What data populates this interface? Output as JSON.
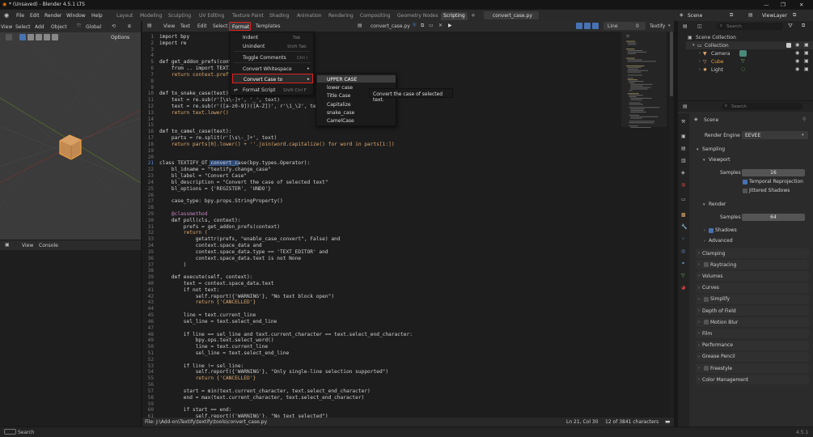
{
  "titlebar": {
    "title": "* (Unsaved) - Blender 4.5.1 LTS",
    "minimize": "—",
    "maximize": "❐",
    "close": "✕"
  },
  "topbar": {
    "menus": [
      "File",
      "Edit",
      "Render",
      "Window",
      "Help"
    ],
    "workspaces": [
      "Layout",
      "Modeling",
      "Sculpting",
      "UV Editing",
      "Texture Paint",
      "Shading",
      "Animation",
      "Rendering",
      "Compositing",
      "Geometry Nodes",
      "Scripting"
    ],
    "active_workspace": "Scripting",
    "add_tab": "+",
    "file_tab": "convert_case.py",
    "scene_label": "Scene",
    "view_layer_label": "ViewLayer"
  },
  "viewport": {
    "header_menus": [
      "View",
      "Select",
      "Add",
      "Object"
    ],
    "transform_orientation": "Global",
    "options_label": "Options"
  },
  "console": {
    "menus": [
      "View",
      "Console"
    ]
  },
  "editor_header": {
    "menus": [
      "View",
      "Text",
      "Edit",
      "Select",
      "Format",
      "Templates"
    ],
    "active_menu": "Format",
    "file_name": "convert_case.py",
    "line_label": "Line",
    "line_value": "0",
    "addon_label": "Textify"
  },
  "format_menu": {
    "items": [
      {
        "label": "Indent",
        "shortcut": "Tab"
      },
      {
        "label": "Unindent",
        "shortcut": "Shift Tab"
      },
      {
        "label": "Toggle Comments",
        "shortcut": "Ctrl /"
      },
      {
        "label": "Convert Whitespace",
        "shortcut": "▸"
      },
      {
        "label": "Convert Case to",
        "shortcut": "▸"
      },
      {
        "label": "Format Script",
        "shortcut": "Shift Ctrl F"
      }
    ]
  },
  "case_submenu": {
    "items": [
      "UPPER CASE",
      "lower case",
      "Title Case",
      "Capitalize",
      "snake_case",
      "CamelCase"
    ],
    "tooltip": "Convert the case of selected text."
  },
  "code_lines": [
    {
      "n": "1",
      "text": "import bpy"
    },
    {
      "n": "2",
      "text": "import re"
    },
    {
      "n": "3",
      "text": ""
    },
    {
      "n": "4",
      "text": ""
    },
    {
      "n": "5",
      "text": "def get_addon_prefs(cont"
    },
    {
      "n": "6",
      "text": "    from .. import TEXTI"
    },
    {
      "n": "7",
      "text": "    return context.pref"
    },
    {
      "n": "8",
      "text": ""
    },
    {
      "n": "9",
      "text": ""
    },
    {
      "n": "10",
      "text": "def to_snake_case(text)"
    },
    {
      "n": "11",
      "text": "    text = re.sub(r'[\\s\\-]+', '_', text)"
    },
    {
      "n": "12",
      "text": "    text = re.sub(r'([a-z0-9])([A-Z])', r'\\1_\\2', te"
    },
    {
      "n": "13",
      "text": "    return text.lower()"
    },
    {
      "n": "14",
      "text": ""
    },
    {
      "n": "15",
      "text": ""
    },
    {
      "n": "16",
      "text": "def to_camel_case(text):"
    },
    {
      "n": "17",
      "text": "    parts = re.split(r'[\\s\\-_]+', text)"
    },
    {
      "n": "18",
      "text": "    return parts[0].lower() + ''.join(word.capitalize() for word in parts[1:])"
    },
    {
      "n": "19",
      "text": ""
    },
    {
      "n": "20",
      "text": ""
    },
    {
      "n": "21",
      "text": "class TEXTIFY_OT_convert_case(bpy.types.Operator):"
    },
    {
      "n": "22",
      "text": "    bl_idname = \"textify.change_case\""
    },
    {
      "n": "23",
      "text": "    bl_label = \"Convert Case\""
    },
    {
      "n": "24",
      "text": "    bl_description = \"Convert the case of selected text\""
    },
    {
      "n": "25",
      "text": "    bl_options = {'REGISTER', 'UNDO'}"
    },
    {
      "n": "26",
      "text": ""
    },
    {
      "n": "27",
      "text": "    case_type: bpy.props.StringProperty()"
    },
    {
      "n": "28",
      "text": ""
    },
    {
      "n": "29",
      "text": "    @classmethod"
    },
    {
      "n": "30",
      "text": "    def poll(cls, context):"
    },
    {
      "n": "31",
      "text": "        prefs = get_addon_prefs(context)"
    },
    {
      "n": "32",
      "text": "        return ("
    },
    {
      "n": "33",
      "text": "            getattr(prefs, \"enable_case_convert\", False) and"
    },
    {
      "n": "34",
      "text": "            context.space_data and"
    },
    {
      "n": "35",
      "text": "            context.space_data.type == 'TEXT_EDITOR' and"
    },
    {
      "n": "36",
      "text": "            context.space_data.text is not None"
    },
    {
      "n": "37",
      "text": "        )"
    },
    {
      "n": "38",
      "text": ""
    },
    {
      "n": "39",
      "text": "    def execute(self, context):"
    },
    {
      "n": "40",
      "text": "        text = context.space_data.text"
    },
    {
      "n": "41",
      "text": "        if not text:"
    },
    {
      "n": "42",
      "text": "            self.report({'WARNING'}, \"No text block open\")"
    },
    {
      "n": "43",
      "text": "            return {'CANCELLED'}"
    },
    {
      "n": "44",
      "text": ""
    },
    {
      "n": "45",
      "text": "        line = text.current_line"
    },
    {
      "n": "46",
      "text": "        sel_line = text.select_end_line"
    },
    {
      "n": "47",
      "text": ""
    },
    {
      "n": "48",
      "text": "        if line == sel_line and text.current_character == text.select_end_character:"
    },
    {
      "n": "49",
      "text": "            bpy.ops.text.select_word()"
    },
    {
      "n": "50",
      "text": "            line = text.current_line"
    },
    {
      "n": "51",
      "text": "            sel_line = text.select_end_line"
    },
    {
      "n": "52",
      "text": ""
    },
    {
      "n": "53",
      "text": "        if line != sel_line:"
    },
    {
      "n": "54",
      "text": "            self.report({'WARNING'}, \"Only single-line selection supported\")"
    },
    {
      "n": "55",
      "text": "            return {'CANCELLED'}"
    },
    {
      "n": "56",
      "text": ""
    },
    {
      "n": "57",
      "text": "        start = min(text.current_character, text.select_end_character)"
    },
    {
      "n": "58",
      "text": "        end = max(text.current_character, text.select_end_character)"
    },
    {
      "n": "59",
      "text": ""
    },
    {
      "n": "60",
      "text": "        if start == end:"
    },
    {
      "n": "61",
      "text": "            self.report({'WARNING'}, \"No text selected\")"
    }
  ],
  "editor_status": {
    "file": "File: J:\\Add-on\\Textify\\textify\\tools\\convert_case.py",
    "position": "Ln 21, Col 30",
    "chars": "12 of 3841 characters"
  },
  "outliner": {
    "search_placeholder": "Search",
    "root": "Scene Collection",
    "items": [
      {
        "label": "Collection",
        "level": 1
      },
      {
        "label": "Camera",
        "level": 2
      },
      {
        "label": "Cube",
        "level": 2
      },
      {
        "label": "Light",
        "level": 2
      }
    ]
  },
  "properties": {
    "search_placeholder": "Search",
    "scene_label": "Scene",
    "render_engine_label": "Render Engine",
    "render_engine_value": "EEVEE",
    "sampling": "Sampling",
    "viewport": "Viewport",
    "samples_label": "Samples",
    "viewport_samples": "16",
    "temporal_reprojection": "Temporal Reprojection",
    "jittered_shadows": "Jittered Shadows",
    "render": "Render",
    "render_samples": "64",
    "shadows": "Shadows",
    "advanced": "Advanced",
    "panels": [
      "Clamping",
      "Raytracing",
      "Volumes",
      "Curves",
      "Simplify",
      "Depth of Field",
      "Motion Blur",
      "Film",
      "Performance",
      "Grease Pencil",
      "Freestyle",
      "Color Management"
    ]
  },
  "bottombar": {
    "search_label": "Search",
    "version": "4.5.1"
  },
  "colors": {
    "accent": "#4772b3",
    "highlight_red": "#e02020",
    "keyword": "#cc7832",
    "string": "#e8bf6a",
    "function": "#e0a96d"
  }
}
